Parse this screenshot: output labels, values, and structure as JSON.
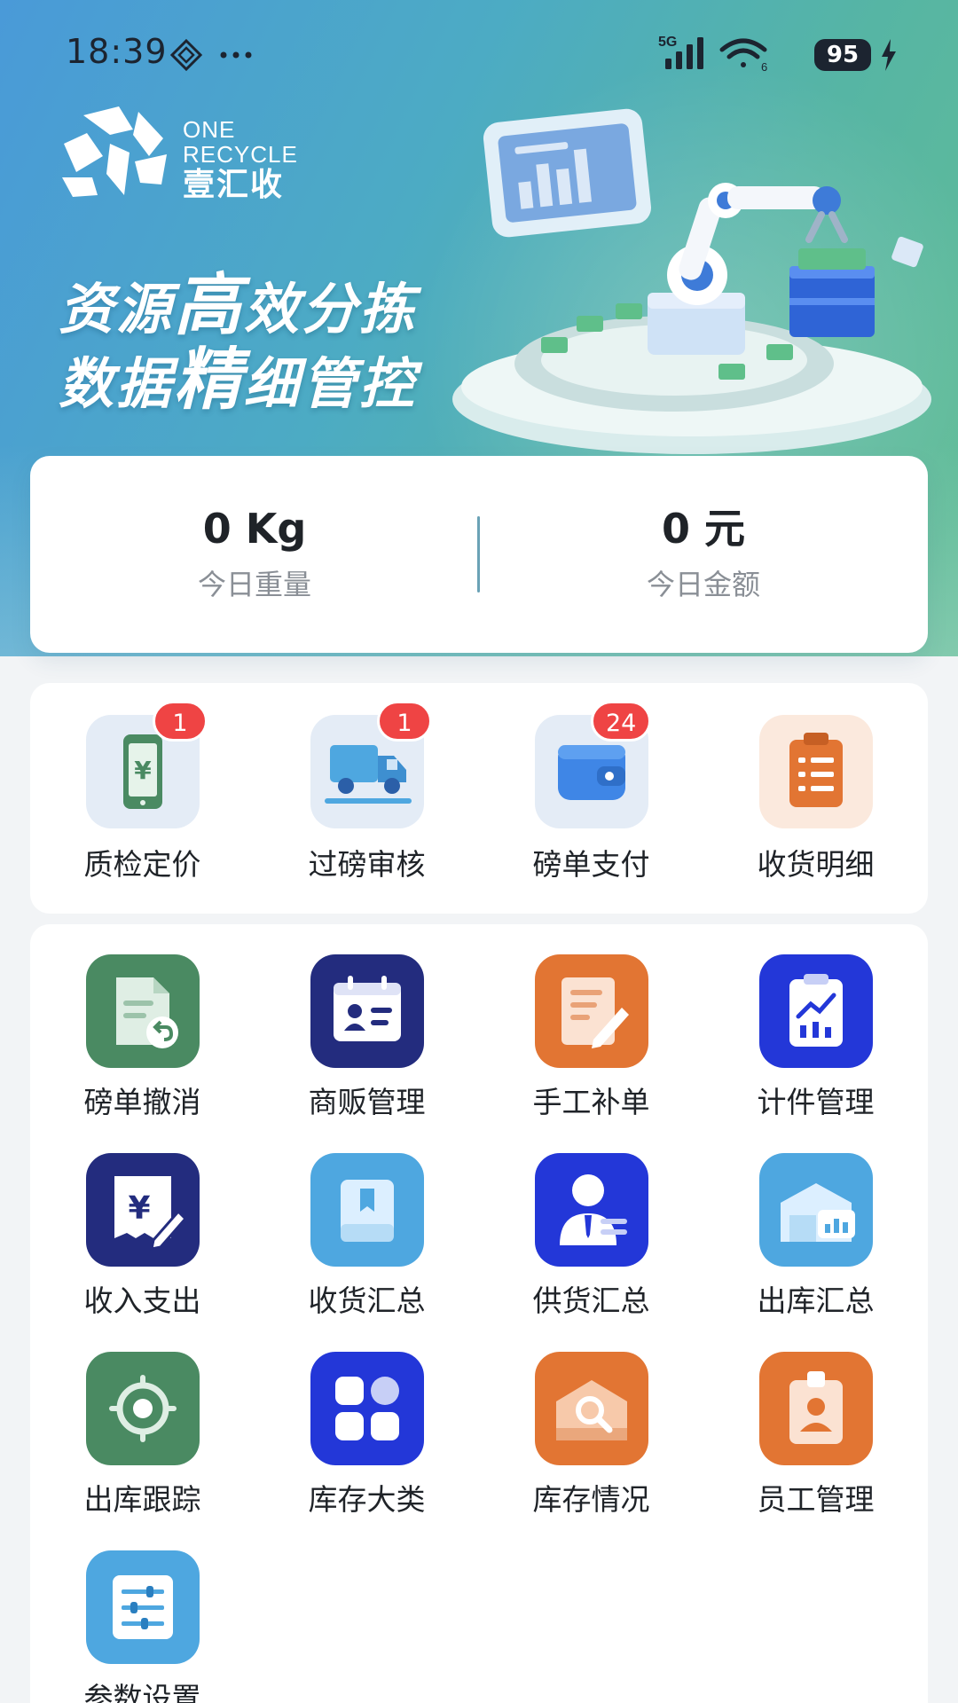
{
  "status_bar": {
    "time": "18:39",
    "network": "5G",
    "wifi_level": "6",
    "battery": "95"
  },
  "brand": {
    "name_en_line1": "ONE",
    "name_en_line2": "RECYCLE",
    "name_cn": "壹汇收"
  },
  "banner": {
    "slogan1_pre": "资源",
    "slogan1_big": "高",
    "slogan1_post": "效分拣",
    "slogan2_pre": "数据",
    "slogan2_big": "精",
    "slogan2_post": "细管控"
  },
  "stats": {
    "weight_value": "0 Kg",
    "weight_label": "今日重量",
    "amount_value": "0 元",
    "amount_label": "今日金额"
  },
  "top_actions": [
    {
      "label": "质检定价",
      "badge": "1",
      "icon": "phone-yuan-icon"
    },
    {
      "label": "过磅审核",
      "badge": "1",
      "icon": "truck-icon"
    },
    {
      "label": "磅单支付",
      "badge": "24",
      "icon": "wallet-icon"
    },
    {
      "label": "收货明细",
      "badge": "",
      "icon": "clipboard-list-icon"
    }
  ],
  "features": [
    {
      "label": "磅单撤消",
      "icon": "document-undo-icon",
      "color": "#4a8a62"
    },
    {
      "label": "商贩管理",
      "icon": "contact-card-icon",
      "color": "#232c7e"
    },
    {
      "label": "手工补单",
      "icon": "document-edit-icon",
      "color": "#e27533"
    },
    {
      "label": "计件管理",
      "icon": "chart-clipboard-icon",
      "color": "#2337d8"
    },
    {
      "label": "收入支出",
      "icon": "receipt-yuan-icon",
      "color": "#232c7e"
    },
    {
      "label": "收货汇总",
      "icon": "package-icon",
      "color": "#4ea7e0"
    },
    {
      "label": "供货汇总",
      "icon": "supplier-person-icon",
      "color": "#2337d8"
    },
    {
      "label": "出库汇总",
      "icon": "warehouse-chart-icon",
      "color": "#4ea7e0"
    },
    {
      "label": "出库跟踪",
      "icon": "target-icon",
      "color": "#4a8a62"
    },
    {
      "label": "库存大类",
      "icon": "category-grid-icon",
      "color": "#2337d8"
    },
    {
      "label": "库存情况",
      "icon": "inventory-search-icon",
      "color": "#e27533"
    },
    {
      "label": "员工管理",
      "icon": "employee-badge-icon",
      "color": "#e27533"
    },
    {
      "label": "参数设置",
      "icon": "settings-sliders-icon",
      "color": "#4ea7e0"
    }
  ]
}
